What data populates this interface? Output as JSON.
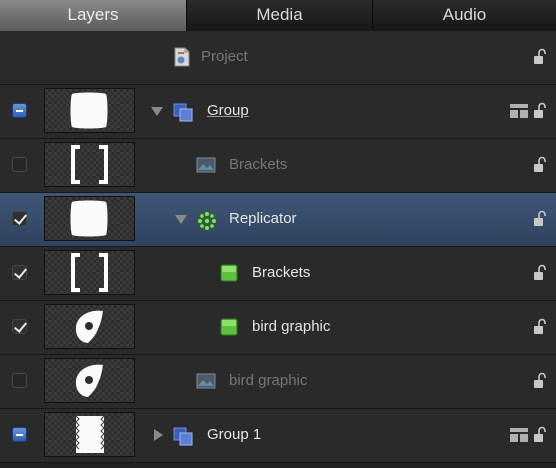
{
  "tabs": [
    {
      "label": "Layers",
      "active": true
    },
    {
      "label": "Media",
      "active": false
    },
    {
      "label": "Audio",
      "active": false
    }
  ],
  "rows": [
    {
      "label": "Project",
      "icon": "project-file-icon",
      "enabled": true
    },
    {
      "label": "Group",
      "icon": "group-icon",
      "checkbox": "mixed",
      "expanded": true
    },
    {
      "label": "Brackets",
      "icon": "image-icon",
      "checkbox": "unchecked",
      "dimmed": true
    },
    {
      "label": "Replicator",
      "icon": "replicator-icon",
      "checkbox": "checked",
      "expanded": true,
      "selected": true
    },
    {
      "label": "Brackets",
      "icon": "replicator-cell-icon",
      "checkbox": "checked"
    },
    {
      "label": "bird graphic",
      "icon": "replicator-cell-icon",
      "checkbox": "checked"
    },
    {
      "label": "bird graphic",
      "icon": "image-icon",
      "checkbox": "unchecked",
      "dimmed": true
    },
    {
      "label": "Group 1",
      "icon": "group-icon",
      "checkbox": "mixed",
      "expanded": false
    }
  ],
  "colors": {
    "selection": "#37506f",
    "row": "#2a2a2a",
    "checkbox_mixed": "#3f74c8",
    "cell_green": "#5fbf3f"
  }
}
